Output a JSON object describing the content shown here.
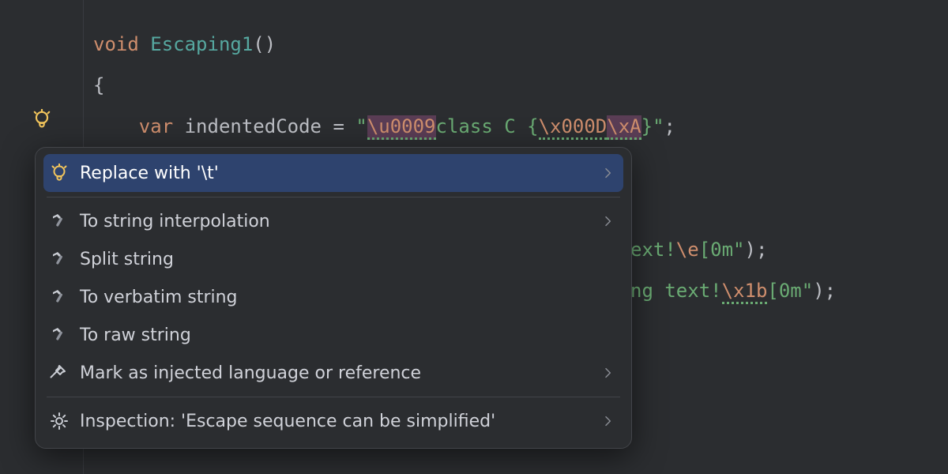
{
  "code": {
    "line1": {
      "void": "void",
      "name": "Escaping1",
      "parens": "()"
    },
    "line2": {
      "brace": "{"
    },
    "line3": {
      "var": "var",
      "ident": "indentedCode",
      "eq": " = ",
      "q1": "\"",
      "esc1": "\\u0009",
      "mid": "class C {",
      "esc2": "\\x000D",
      "esc3": "\\xA",
      "close": "}",
      "q2": "\"",
      "semi": ";"
    }
  },
  "frag1": {
    "a": "ext!",
    "esc": "\\e",
    "b": "[0m\"",
    "c": ");"
  },
  "frag2": {
    "a": "ng text!",
    "esc": "\\x1b",
    "b": "[0m\"",
    "c": ");"
  },
  "popup": {
    "items": [
      {
        "label": "Replace with '\\t'",
        "icon": "bulb",
        "selected": true,
        "chevron": true
      },
      {
        "label": "To string interpolation",
        "icon": "hammer",
        "selected": false,
        "chevron": true
      },
      {
        "label": "Split string",
        "icon": "hammer",
        "selected": false,
        "chevron": false
      },
      {
        "label": "To verbatim string",
        "icon": "hammer",
        "selected": false,
        "chevron": false
      },
      {
        "label": "To raw string",
        "icon": "hammer",
        "selected": false,
        "chevron": false
      },
      {
        "label": "Mark as injected language or reference",
        "icon": "pin",
        "selected": false,
        "chevron": true
      },
      {
        "label": "Inspection: 'Escape sequence can be simplified'",
        "icon": "gear",
        "selected": false,
        "chevron": true
      }
    ]
  },
  "colors": {
    "bg": "#2b2d30",
    "selection": "#2e436e",
    "keyword": "#cf8e6d",
    "string": "#6aab73",
    "type": "#56a8a0"
  }
}
